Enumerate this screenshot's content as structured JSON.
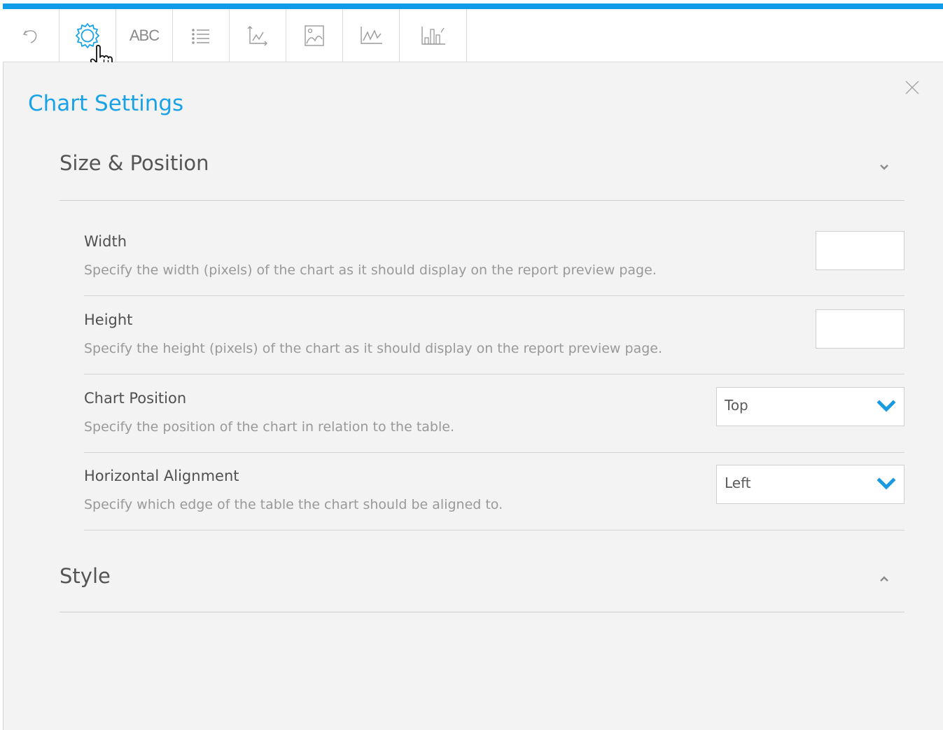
{
  "toolbar": {
    "items": [
      {
        "icon": "undo-icon"
      },
      {
        "icon": "gear-icon",
        "active": true
      },
      {
        "icon": "text-icon",
        "label": "ABC"
      },
      {
        "icon": "list-icon"
      },
      {
        "icon": "axis-icon"
      },
      {
        "icon": "image-icon"
      },
      {
        "icon": "line-chart-icon"
      },
      {
        "icon": "bar-chart-icon"
      }
    ],
    "accent_color": "#0f9be8"
  },
  "panel": {
    "title": "Chart Settings",
    "close_icon": "close-icon",
    "sections": {
      "size_position": {
        "title": "Size & Position",
        "expanded": true,
        "fields": {
          "width": {
            "label": "Width",
            "description": "Specify the width (pixels) of the chart as it should display on the report preview page.",
            "value": ""
          },
          "height": {
            "label": "Height",
            "description": "Specify the height (pixels) of the chart as it should display on the report preview page.",
            "value": ""
          },
          "chart_position": {
            "label": "Chart Position",
            "description": "Specify the position of the chart in relation to the table.",
            "value": "Top"
          },
          "horizontal_alignment": {
            "label": "Horizontal Alignment",
            "description": "Specify which edge of the table the chart should be aligned to.",
            "value": "Left"
          }
        }
      },
      "style": {
        "title": "Style",
        "expanded": false
      }
    }
  },
  "colors": {
    "title": "#1aa2e6",
    "select_arrow": "#1a9ae0",
    "panel_bg": "#f3f3f3"
  }
}
